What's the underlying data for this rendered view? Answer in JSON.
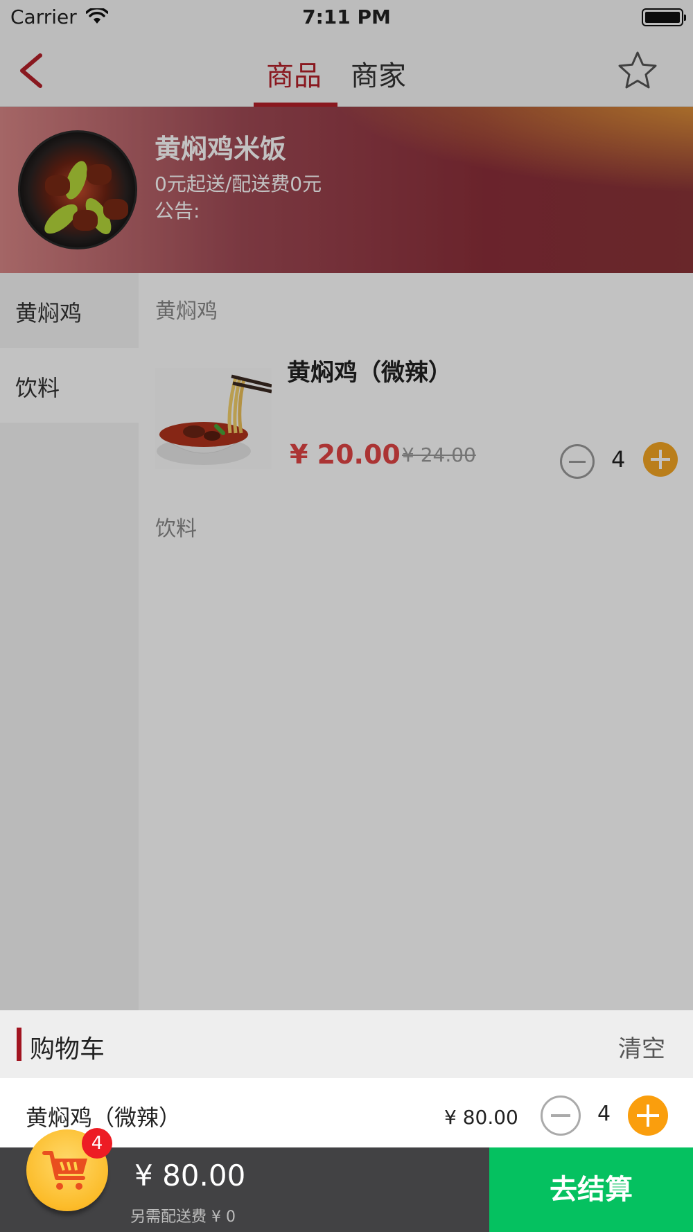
{
  "status_bar": {
    "carrier": "Carrier",
    "time": "7:11 PM"
  },
  "nav": {
    "tabs": [
      "商品",
      "商家"
    ],
    "active_tab": 0
  },
  "shop": {
    "name": "黄焖鸡米饭",
    "delivery_info": "0元起送/配送费0元",
    "notice": "公告:"
  },
  "categories": [
    "黄焖鸡",
    "饮料"
  ],
  "active_category": 1,
  "menu": {
    "section_1": "黄焖鸡",
    "section_2": "饮料",
    "item": {
      "name": "黄焖鸡（微辣）",
      "price": "¥ 20.00",
      "original_price": "¥ 24.00",
      "quantity": "4"
    }
  },
  "cart": {
    "title": "购物车",
    "clear": "清空",
    "item": {
      "name": "黄焖鸡（微辣）",
      "price": "¥ 80.00",
      "quantity": "4"
    },
    "badge": "4",
    "total": "¥ 80.00",
    "delivery_fee": "另需配送费 ¥ 0",
    "checkout": "去结算"
  },
  "colors": {
    "accent": "#b5202a",
    "price": "#e14545",
    "plus": "#fa9e0d",
    "checkout": "#05c160"
  }
}
